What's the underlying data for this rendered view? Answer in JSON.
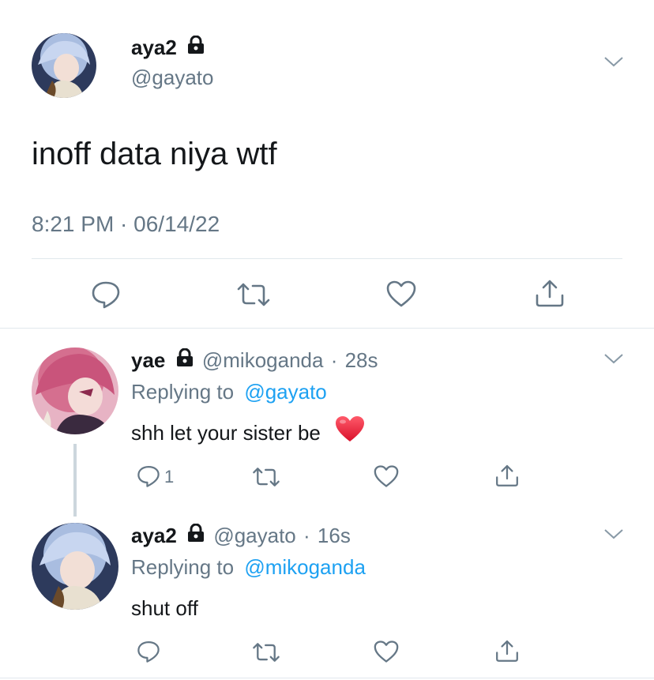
{
  "main_tweet": {
    "display_name": "aya2",
    "handle": "@gayato",
    "text": "inoff data niya wtf",
    "timestamp": "8:21 PM · 06/14/22",
    "locked": true
  },
  "replies": [
    {
      "display_name": "yae",
      "handle": "@mikoganda",
      "time_sep": "·",
      "time": "28s",
      "replying_prefix": "Replying to",
      "replying_to": "@gayato",
      "text": "shh let your sister be",
      "emoji": "❤️",
      "reply_count": "1",
      "locked": true
    },
    {
      "display_name": "aya2",
      "handle": "@gayato",
      "time_sep": "·",
      "time": "16s",
      "replying_prefix": "Replying to",
      "replying_to": "@mikoganda",
      "text": "shut off",
      "locked": true
    }
  ],
  "colors": {
    "text": "#14171a",
    "secondary": "#657786",
    "link": "#1da1f2",
    "divider": "#e1e8ed",
    "heart_emoji": "#e0245e"
  }
}
